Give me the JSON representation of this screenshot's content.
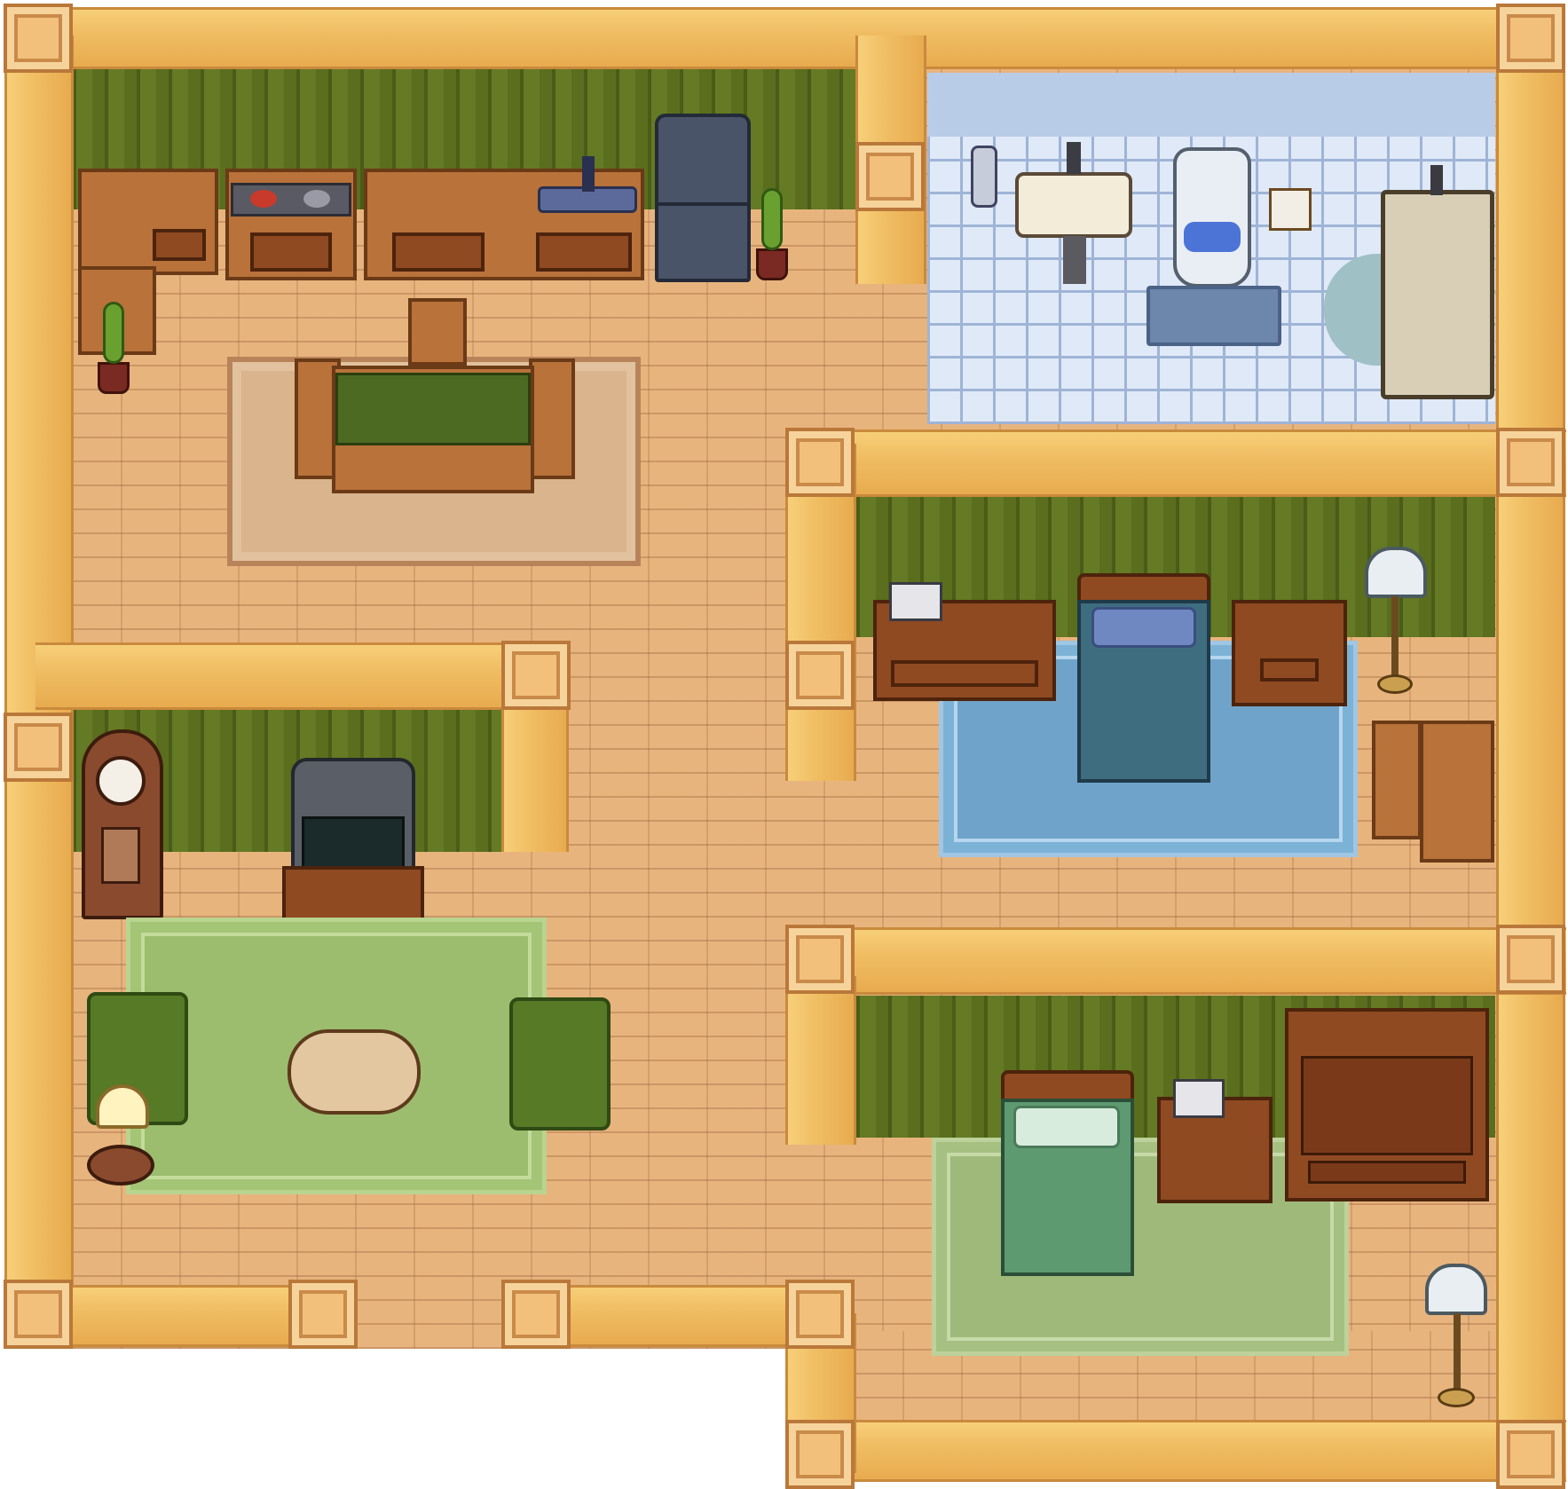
{
  "scene": {
    "type": "top-down pixel-art house interior",
    "rooms": [
      "kitchen-dining",
      "bathroom",
      "bedroom-upper",
      "living-room",
      "bedroom-lower"
    ]
  },
  "colors": {
    "floor": "#e8b47e",
    "wall_trim": "#f0bd62",
    "wallpaper": "#5a6e1e",
    "bath_tile": "#dfe9f7",
    "blue_rug": "#6fa3c9",
    "green_rug": "#9cbc6e",
    "tan_rug": "#d9b48c",
    "tv_screen_label": "#1b2a2a"
  },
  "icons": {
    "clock": "clock-icon",
    "phone": "phone-icon",
    "tv": "tv-icon",
    "plant": "potted-plant-icon",
    "lamp": "floor-lamp-icon"
  }
}
